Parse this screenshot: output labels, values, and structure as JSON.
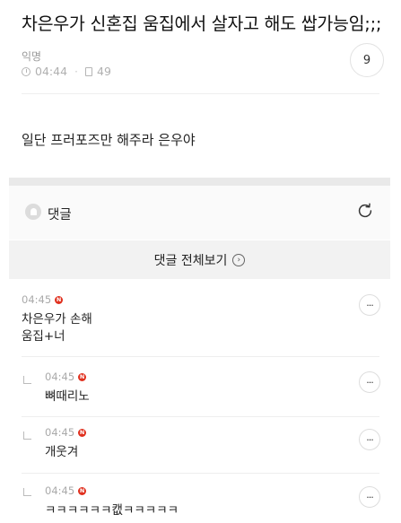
{
  "post": {
    "title": "차은우가 신혼집 움집에서 살자고 해도 쌉가능임;;;",
    "author": "익명",
    "time": "04:44",
    "views": "49",
    "comment_count": "9",
    "body": "일단 프러포즈만 해주라 은우야"
  },
  "comments_section": {
    "title": "댓글",
    "view_all": "댓글 전체보기",
    "view_all_icon": "chevron-right-icon",
    "refresh_icon": "refresh-icon"
  },
  "comments": [
    {
      "time": "04:45",
      "badge": "N",
      "text_line1": "차은우가 손해",
      "text_line2": "움집+너",
      "more": "···"
    },
    {
      "time": "04:45",
      "badge": "N",
      "text": "뼈때리노",
      "more": "···"
    },
    {
      "time": "04:45",
      "badge": "N",
      "text": "개웃겨",
      "more": "···"
    },
    {
      "time": "04:45",
      "badge": "N",
      "text": "ㅋㅋㅋㅋㅋㅋ캢ㅋㅋㅋㅋㅋ",
      "more": "···"
    }
  ],
  "colors": {
    "accent_red": "#e0301e",
    "muted": "#aaaaaa",
    "divider": "#eeeeee"
  }
}
